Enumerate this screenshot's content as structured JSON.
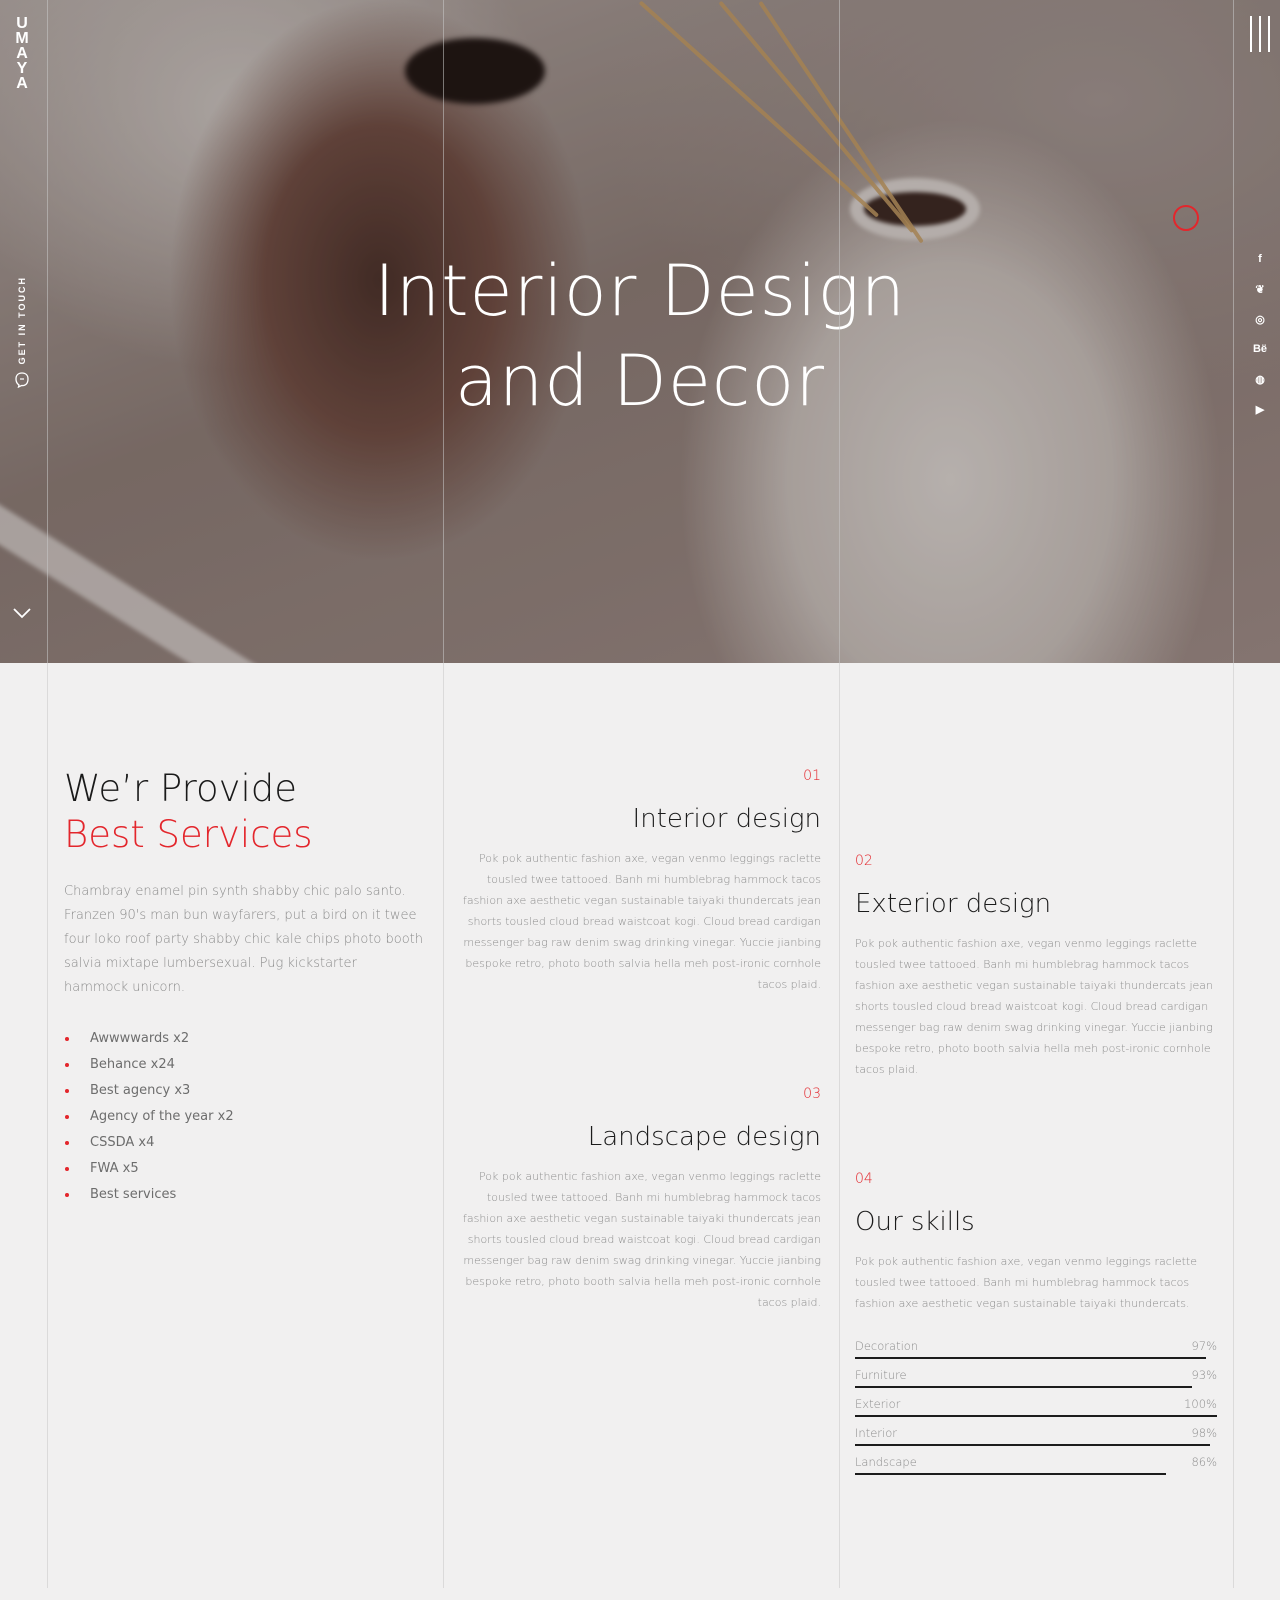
{
  "brand": {
    "logo_letters": [
      "U",
      "M",
      "A",
      "Y",
      "A"
    ]
  },
  "hero": {
    "title_line1": "Interior Design",
    "title_line2": "and Decor",
    "get_in_touch": "GET IN TOUCH"
  },
  "social": [
    {
      "icon": "facebook-icon",
      "glyph": "f"
    },
    {
      "icon": "twitter-icon",
      "glyph": "❦"
    },
    {
      "icon": "instagram-icon",
      "glyph": "◎"
    },
    {
      "icon": "behance-icon",
      "glyph": "Bë"
    },
    {
      "icon": "dribbble-icon",
      "glyph": "◍"
    },
    {
      "icon": "youtube-icon",
      "glyph": "▶"
    }
  ],
  "colors": {
    "accent": "#e3262c",
    "text": "#1c1c1c",
    "muted": "#8d8d8d"
  },
  "intro": {
    "heading_line1": "We’r Provide",
    "heading_line2": "Best Services",
    "body": "Chambray enamel pin synth shabby chic palo santo. Franzen 90's man bun wayfarers, put a bird on it twee four loko roof party shabby chic kale chips photo booth salvia mixtape lumbersexual. Pug kickstarter hammock unicorn.",
    "awards": [
      "Awwwwards x2",
      "Behance x24",
      "Best agency x3",
      "Agency of the year x2",
      "CSSDA x4",
      "FWA x5",
      "Best services"
    ]
  },
  "services": [
    {
      "number": "01",
      "title": "Interior design",
      "body": "Pok pok authentic fashion axe, vegan venmo leggings raclette tousled twee tattooed. Banh mi humblebrag hammock tacos fashion axe aesthetic vegan sustainable taiyaki thundercats jean shorts tousled cloud bread waistcoat kogi. Cloud bread cardigan messenger bag raw denim swag drinking vinegar. Yuccie jianbing bespoke retro, photo booth salvia hella meh post-ironic cornhole tacos plaid."
    },
    {
      "number": "02",
      "title": "Exterior design",
      "body": "Pok pok authentic fashion axe, vegan venmo leggings raclette tousled twee tattooed. Banh mi humblebrag hammock tacos fashion axe aesthetic vegan sustainable taiyaki thundercats jean shorts tousled cloud bread waistcoat kogi. Cloud bread cardigan messenger bag raw denim swag drinking vinegar. Yuccie jianbing bespoke retro, photo booth salvia hella meh post-ironic cornhole tacos plaid."
    },
    {
      "number": "03",
      "title": "Landscape design",
      "body": "Pok pok authentic fashion axe, vegan venmo leggings raclette tousled twee tattooed. Banh mi humblebrag hammock tacos fashion axe aesthetic vegan sustainable taiyaki thundercats jean shorts tousled cloud bread waistcoat kogi. Cloud bread cardigan messenger bag raw denim swag drinking vinegar. Yuccie jianbing bespoke retro, photo booth salvia hella meh post-ironic cornhole tacos plaid."
    },
    {
      "number": "04",
      "title": "Our skills",
      "body": "Pok pok authentic fashion axe, vegan venmo leggings raclette tousled twee tattooed. Banh mi humblebrag hammock tacos fashion axe aesthetic vegan sustainable taiyaki thundercats."
    }
  ],
  "skills": [
    {
      "name": "Decoration",
      "value": 97,
      "label": "97%"
    },
    {
      "name": "Furniture",
      "value": 93,
      "label": "93%"
    },
    {
      "name": "Exterior",
      "value": 100,
      "label": "100%"
    },
    {
      "name": "Interior",
      "value": 98,
      "label": "98%"
    },
    {
      "name": "Landscape",
      "value": 86,
      "label": "86%"
    }
  ]
}
